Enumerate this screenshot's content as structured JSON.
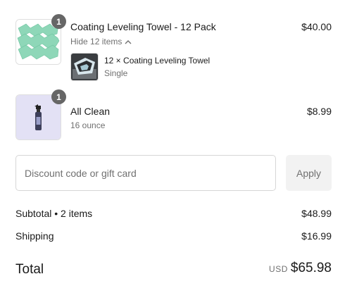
{
  "items": [
    {
      "quantity": "1",
      "title": "Coating Leveling Towel - 12 Pack",
      "toggle_label": "Hide 12 items",
      "toggle_icon": "chevron-up-icon",
      "price": "$40.00",
      "image": "green-towels-image",
      "bundle": {
        "title": "12 × Coating Leveling Towel",
        "variant": "Single",
        "image": "towel-photo-image"
      }
    },
    {
      "quantity": "1",
      "title": "All Clean",
      "variant": "16 ounce",
      "price": "$8.99",
      "image": "spray-bottle-image"
    }
  ],
  "discount": {
    "placeholder": "Discount code or gift card",
    "apply_label": "Apply"
  },
  "summary": {
    "subtotal_label": "Subtotal • 2 items",
    "subtotal_value": "$48.99",
    "shipping_label": "Shipping",
    "shipping_value": "$16.99",
    "total_label": "Total",
    "currency": "USD",
    "total_value": "$65.98"
  },
  "colors": {
    "towel_green": "#8ed7b8",
    "badge_gray": "#666666",
    "muted_text": "#707070",
    "bottle_bg": "#e3e1f5"
  }
}
